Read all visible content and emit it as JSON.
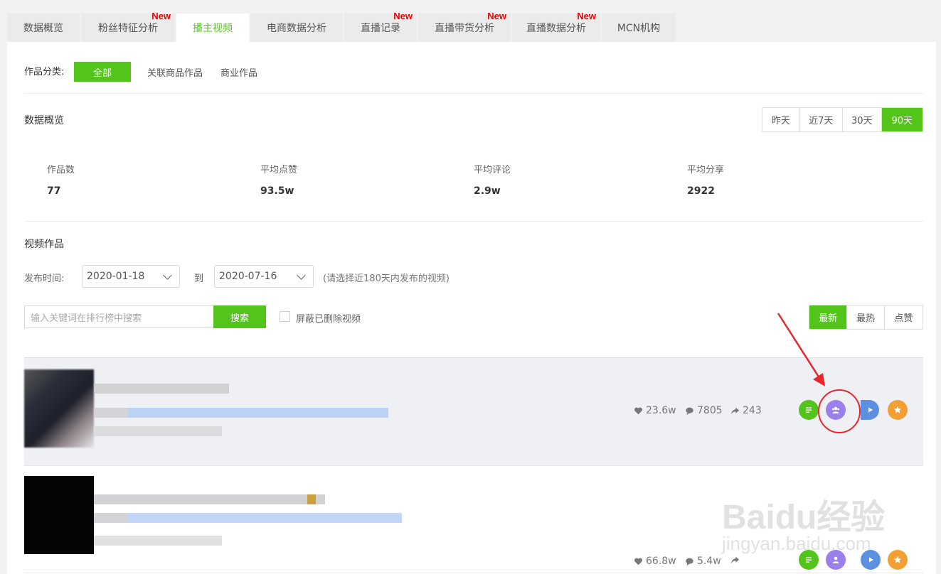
{
  "tabs": [
    {
      "label": "数据概览",
      "new": false,
      "active": false
    },
    {
      "label": "粉丝特征分析",
      "new": true,
      "active": false
    },
    {
      "label": "播主视频",
      "new": false,
      "active": true
    },
    {
      "label": "电商数据分析",
      "new": false,
      "active": false
    },
    {
      "label": "直播记录",
      "new": true,
      "active": false
    },
    {
      "label": "直播带货分析",
      "new": true,
      "active": false
    },
    {
      "label": "直播数据分析",
      "new": true,
      "active": false
    },
    {
      "label": "MCN机构",
      "new": false,
      "active": false
    }
  ],
  "new_badge": "New",
  "category": {
    "label": "作品分类:",
    "options": [
      "全部",
      "关联商品作品",
      "商业作品"
    ],
    "selected": "全部"
  },
  "overview": {
    "title": "数据概览",
    "ranges": [
      "昨天",
      "近7天",
      "30天",
      "90天"
    ],
    "selected_range": "90天",
    "stats": [
      {
        "label": "作品数",
        "value": "77"
      },
      {
        "label": "平均点赞",
        "value": "93.5w"
      },
      {
        "label": "平均评论",
        "value": "2.9w"
      },
      {
        "label": "平均分享",
        "value": "2922"
      }
    ]
  },
  "videos": {
    "title": "视频作品",
    "publish_label": "发布时间:",
    "date_from": "2020-01-18",
    "to_label": "到",
    "date_to": "2020-07-16",
    "date_hint": "(请选择近180天内发布的视频)",
    "search_placeholder": "输入关键词在排行榜中搜索",
    "search_button": "搜索",
    "hide_deleted_label": "屏蔽已删除视频",
    "sort_options": [
      "最新",
      "最热",
      "点赞"
    ],
    "selected_sort": "最新",
    "rows": [
      {
        "likes": "23.6w",
        "comments": "7805",
        "shares": "243"
      },
      {
        "likes": "66.8w",
        "comments": "5.4w",
        "shares": ""
      }
    ]
  },
  "watermark": {
    "brand": "Baidu经验",
    "url": "jingyan.baidu.com"
  },
  "colors": {
    "accent": "#52c41a",
    "new_badge": "#e00000",
    "annotation": "#e8262d"
  },
  "action_icons": [
    "detail-icon",
    "audience-icon",
    "play-icon",
    "star-icon"
  ]
}
